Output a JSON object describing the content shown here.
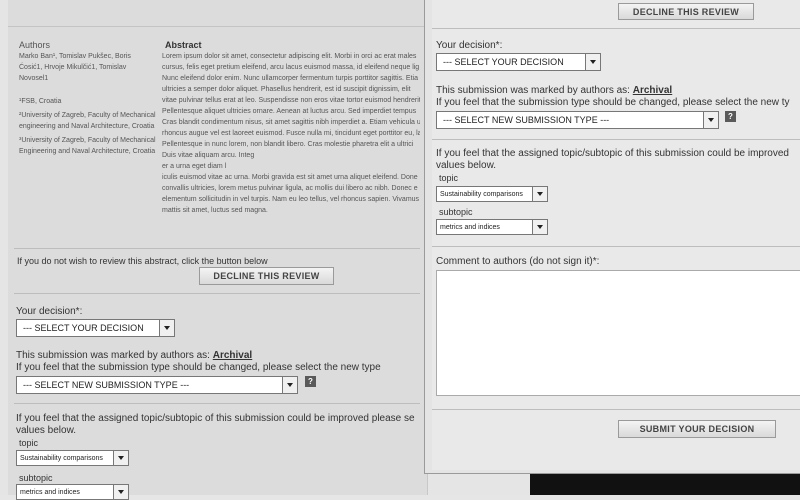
{
  "abstract_panel": {
    "authors_heading": "Authors",
    "authors_line1": "Marko Ban¹, Tomislav Pukšec, Boris",
    "authors_line2": "Ćosić1, Hrvoje Mikulčić1, Tomislav",
    "authors_line3": "Novosel1",
    "affil1": "¹FSB, Croatia",
    "affil2_line1": "²University of Zagreb, Faculty of Mechanical",
    "affil2_line2": "engineering and Naval Architecture, Croatia",
    "affil3_line1": "³University of Zagreb, Faculty of Mechanical",
    "affil3_line2": "Engineering and Naval Architecture, Croatia",
    "abstract_heading": "Abstract",
    "abstract_lines": [
      "Lorem ipsum dolor sit amet, consectetur adipiscing elit. Morbi in orci ac erat males",
      "cursus, felis eget pretium eleifend, arcu lacus euismod massa, id eleifend neque lig",
      "Nunc eleifend dolor enim. Nunc ullamcorper fermentum turpis porttitor sagittis. Etia",
      "ultricies a semper dolor aliquet. Phasellus hendrerit, est id suscipit dignissim, elit",
      "vitae pulvinar tellus erat at leo. Suspendisse non eros vitae tortor euismod hendrerit.",
      "Pellentesque aliquet ultricies ornare. Aenean at luctus arcu. Sed imperdiet tempus",
      "Cras blandit condimentum nisus, sit amet sagittis nibh imperdiet a. Etiam vehicula u",
      "rhoncus augue vel est laoreet euismod. Fusce nulla mi, tincidunt eget porttitor eu, la",
      "Pellentesque in nunc lorem, non blandit libero. Cras molestie pharetra elit a ultrici",
      "Duis vitae aliquam arcu. Integ",
      "er a urna eget diam l",
      "iculis euismod vitae ac urna. Morbi gravida est sit amet urna aliquet eleifend. Done",
      "convallis ultricies, lorem metus pulvinar ligula, ac mollis dui libero ac nibh. Donec e",
      "elementum sollicitudin in vel turpis. Nam eu leo tellus, vel rhoncus sapien. Vivamus",
      "mattis sit amet, luctus sed magna."
    ],
    "decline_prompt": "If you do not wish to review this abstract, click the button below",
    "decline_button": "DECLINE THIS REVIEW",
    "decision_label": "Your decision*:",
    "decision_select": "--- SELECT YOUR DECISION",
    "marked_as_prefix": "This submission was marked by authors as:",
    "marked_as_value": "Archival",
    "change_type_prompt": "If you feel that the submission type should be changed, please select the new type",
    "submission_type_select": "--- SELECT NEW SUBMISSION TYPE ---",
    "help_icon_text": "?",
    "topic_prompt_line1": "If you feel that the assigned topic/subtopic of this submission could be improved please se",
    "topic_prompt_line2": "values below.",
    "topic_label": "topic",
    "topic_select": "Sustainability comparisons",
    "subtopic_label": "subtopic",
    "subtopic_select": "metrics and indices"
  },
  "modal": {
    "decline_button": "DECLINE THIS REVIEW",
    "decision_label": "Your decision*:",
    "decision_select": "--- SELECT YOUR DECISION",
    "marked_as_prefix": "This submission was marked by authors as:",
    "marked_as_value": "Archival",
    "change_type_prompt": "If you feel that the submission type should be changed, please select the new ty",
    "submission_type_select": "--- SELECT NEW SUBMISSION TYPE ---",
    "help_icon_text": "?",
    "topic_prompt_line1": "If you feel that the assigned topic/subtopic of this submission could be improved",
    "topic_prompt_line2": "values below.",
    "topic_label": "topic",
    "topic_select": "Sustainability comparisons",
    "subtopic_label": "subtopic",
    "subtopic_select": "metrics and indices",
    "comment_label": "Comment to authors (do not sign it)*:",
    "comment_value": "",
    "submit_button": "SUBMIT YOUR DECISION"
  }
}
